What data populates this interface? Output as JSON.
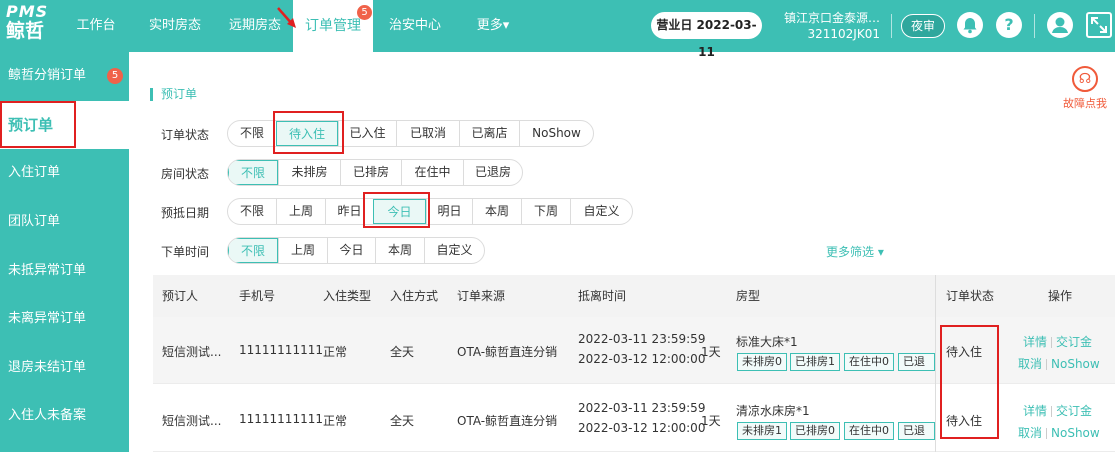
{
  "logo": {
    "line1": "PMS",
    "line2": "鲸哲"
  },
  "nav": {
    "items": [
      {
        "label": "工作台"
      },
      {
        "label": "实时房态"
      },
      {
        "label": "远期房态"
      },
      {
        "label": "订单管理",
        "badge": "5"
      },
      {
        "label": "治安中心"
      },
      {
        "label": "更多▾"
      }
    ]
  },
  "header": {
    "bizday": "营业日 2022-03-11",
    "hotel_name": "镇江京口金泰源…",
    "hotel_code": "321102JK01",
    "night_audit": "夜审"
  },
  "sidebar": {
    "items": [
      {
        "label": "鲸哲分销订单",
        "badge": "5"
      },
      {
        "label": "预订单"
      },
      {
        "label": "入住订单"
      },
      {
        "label": "团队订单"
      },
      {
        "label": "未抵异常订单"
      },
      {
        "label": "未离异常订单"
      },
      {
        "label": "退房未结订单"
      },
      {
        "label": "入住人未备案"
      }
    ]
  },
  "page": {
    "title": "预订单",
    "fault_label": "故障点我"
  },
  "filters": {
    "order_status": {
      "label": "订单状态",
      "options": [
        "不限",
        "待入住",
        "已入住",
        "已取消",
        "已离店",
        "NoShow"
      ]
    },
    "room_status": {
      "label": "房间状态",
      "options": [
        "不限",
        "未排房",
        "已排房",
        "在住中",
        "已退房"
      ]
    },
    "arrival_date": {
      "label": "预抵日期",
      "options": [
        "不限",
        "上周",
        "昨日",
        "今日",
        "明日",
        "本周",
        "下周",
        "自定义"
      ]
    },
    "order_time": {
      "label": "下单时间",
      "options": [
        "不限",
        "上周",
        "今日",
        "本周",
        "自定义"
      ]
    },
    "more": "更多筛选 ▾"
  },
  "table": {
    "headers": [
      "预订人",
      "手机号",
      "入住类型",
      "入住方式",
      "订单来源",
      "抵离时间",
      "房型",
      "订单状态",
      "操作"
    ],
    "rows": [
      {
        "guest": "短信测试...",
        "phone": "11111111111",
        "type": "正常",
        "mode": "全天",
        "source": "OTA-鲸哲直连分销",
        "arrive": "2022-03-11 23:59:59",
        "depart": "2022-03-12 12:00:00",
        "nights": "1天",
        "room": "标准大床*1",
        "pills": [
          "未排房0",
          "已排房1",
          "在住中0",
          "已退房"
        ],
        "status": "待入住",
        "ops": [
          "详情",
          "交订金",
          "取消",
          "NoShow"
        ]
      },
      {
        "guest": "短信测试...",
        "phone": "11111111111",
        "type": "正常",
        "mode": "全天",
        "source": "OTA-鲸哲直连分销",
        "arrive": "2022-03-11 23:59:59",
        "depart": "2022-03-12 12:00:00",
        "nights": "1天",
        "room": "清凉水床房*1",
        "pills": [
          "未排房1",
          "已排房0",
          "在住中0",
          "已退房"
        ],
        "status": "待入住",
        "ops": [
          "详情",
          "交订金",
          "取消",
          "NoShow"
        ]
      }
    ]
  },
  "colors": {
    "brand": "#3dbfb4",
    "badge": "#f0624a",
    "highlight_box": "#e02020"
  }
}
